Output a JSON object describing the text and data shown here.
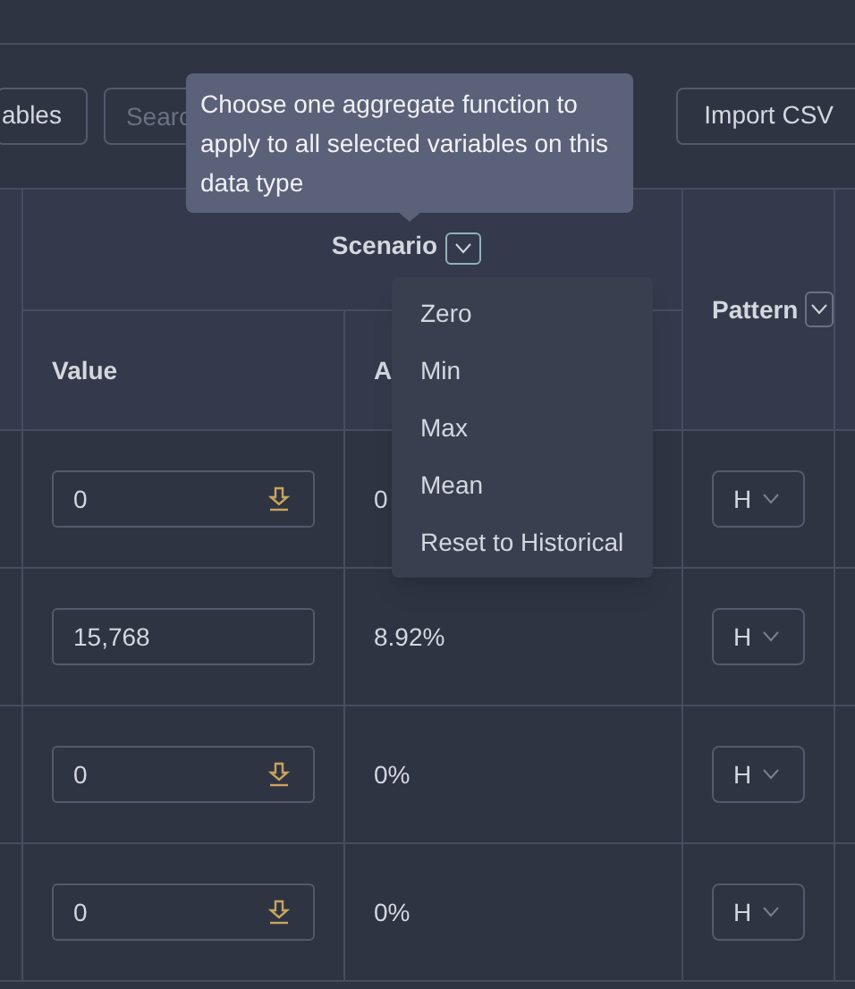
{
  "toolbar": {
    "variables_button": "ables",
    "search": {
      "placeholder": "Searc"
    },
    "import_button": "Import CSV"
  },
  "tooltip": "Choose one aggregate function to apply to all selected variables on this data type",
  "table": {
    "group_header": "Scenario",
    "columns": [
      "Value",
      "A"
    ],
    "pattern_header": "Pattern",
    "rows": [
      {
        "value": "0",
        "percent": "0",
        "pattern": "H",
        "import_icon": true
      },
      {
        "value": "15,768",
        "percent": "8.92%",
        "pattern": "H",
        "import_icon": false
      },
      {
        "value": "0",
        "percent": "0%",
        "pattern": "H",
        "import_icon": true
      },
      {
        "value": "0",
        "percent": "0%",
        "pattern": "H",
        "import_icon": true
      }
    ]
  },
  "menu": {
    "items": [
      "Zero",
      "Min",
      "Max",
      "Mean",
      "Reset to Historical"
    ]
  }
}
